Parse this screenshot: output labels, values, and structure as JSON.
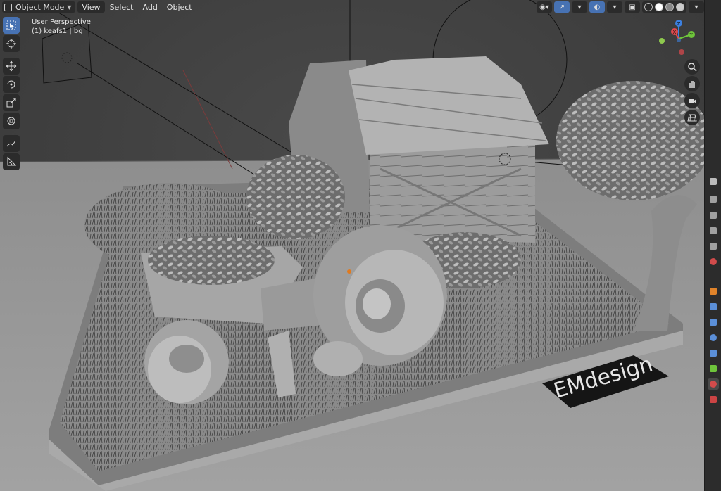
{
  "header": {
    "mode": "Object Mode",
    "menus": [
      "View",
      "Select",
      "Add",
      "Object"
    ]
  },
  "overlay": {
    "perspective": "User Perspective",
    "collection": "(1) keafs1 | bg"
  },
  "toolbar": {
    "tools": [
      "select-box",
      "cursor",
      "move",
      "rotate",
      "scale",
      "transform",
      "annotate",
      "measure"
    ]
  },
  "gizmo": {
    "x": "X",
    "y": "Y",
    "z": "Z"
  },
  "logo": {
    "text": "EMdesign"
  },
  "colors": {
    "accent": "#4772b3",
    "axis_x": "#e0494d",
    "axis_y": "#6ec43b",
    "axis_z": "#3c80e0",
    "header_bg": "#2b2b2b"
  },
  "icons": [
    "select-box-icon",
    "cursor-icon",
    "move-icon",
    "rotate-icon",
    "scale-icon",
    "transform-icon",
    "annotate-icon",
    "measure-icon",
    "zoom-icon",
    "pan-hand-icon",
    "camera-icon",
    "grid-icon",
    "overlay-icon",
    "shading-icon"
  ]
}
